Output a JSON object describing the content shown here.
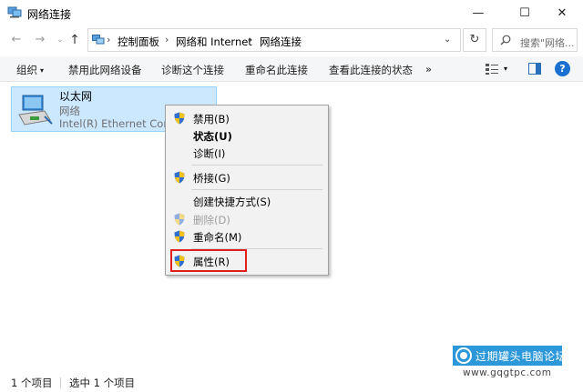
{
  "window": {
    "title": "网络连接",
    "minimize_glyph": "—",
    "maximize_glyph": "☐",
    "close_glyph": "✕"
  },
  "nav": {
    "back_glyph": "←",
    "forward_glyph": "→",
    "recent_glyph": "⌄",
    "up_glyph": "↑",
    "refresh_glyph": "↻",
    "dropdown_glyph": "⌄"
  },
  "breadcrumb": {
    "separator": "›",
    "items": [
      "控制面板",
      "网络和 Internet",
      "网络连接"
    ]
  },
  "search": {
    "placeholder": "搜索\"网络..."
  },
  "toolbar": {
    "organize": "组织",
    "disable_device": "禁用此网络设备",
    "diagnose": "诊断这个连接",
    "rename": "重命名此连接",
    "view_status": "查看此连接的状态",
    "more": "»",
    "help": "?"
  },
  "connection": {
    "name": "以太网",
    "network": "网络",
    "device": "Intel(R) Ethernet Connection"
  },
  "context_menu": {
    "items": [
      {
        "label": "禁用(B)"
      },
      {
        "label": "状态(U)"
      },
      {
        "label": "诊断(I)"
      },
      {
        "label": "桥接(G)"
      },
      {
        "label": "创建快捷方式(S)"
      },
      {
        "label": "删除(D)"
      },
      {
        "label": "重命名(M)"
      },
      {
        "label": "属性(R)"
      }
    ]
  },
  "status": {
    "item_count": "1 个项目",
    "selected": "选中 1 个项目"
  },
  "watermark": {
    "title": "过期罐头电脑论坛",
    "url": "www.gqgtpc.com"
  },
  "colors": {
    "selection_bg": "#cce8ff",
    "highlight_border": "#e0201f",
    "accent": "#1a6fd1"
  }
}
